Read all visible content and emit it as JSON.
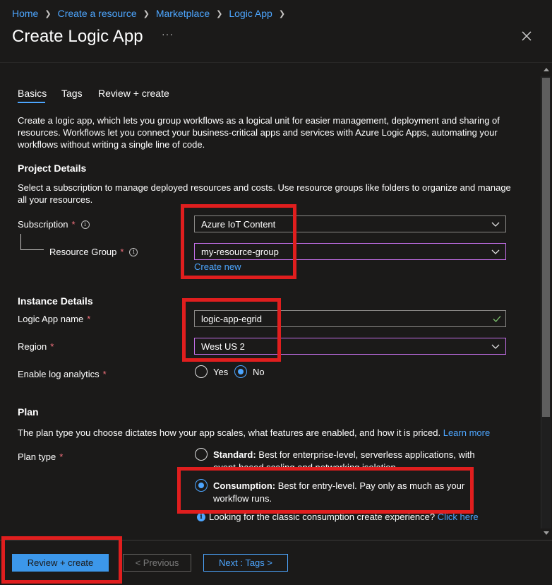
{
  "breadcrumb": [
    "Home",
    "Create a resource",
    "Marketplace",
    "Logic App"
  ],
  "page_title": "Create Logic App",
  "more_label": "···",
  "tabs": [
    {
      "label": "Basics",
      "active": true
    },
    {
      "label": "Tags",
      "active": false
    },
    {
      "label": "Review + create",
      "active": false
    }
  ],
  "intro_text": "Create a logic app, which lets you group workflows as a logical unit for easier management, deployment and sharing of resources. Workflows let you connect your business-critical apps and services with Azure Logic Apps, automating your workflows without writing a single line of code.",
  "project": {
    "heading": "Project Details",
    "description": "Select a subscription to manage deployed resources and costs. Use resource groups like folders to organize and manage all your resources.",
    "subscription_label": "Subscription",
    "subscription_value": "Azure IoT Content",
    "resource_group_label": "Resource Group",
    "resource_group_value": "my-resource-group",
    "create_new": "Create new"
  },
  "instance": {
    "heading": "Instance Details",
    "name_label": "Logic App name",
    "name_value": "logic-app-egrid",
    "region_label": "Region",
    "region_value": "West US 2",
    "log_label": "Enable log analytics",
    "log_options": [
      "Yes",
      "No"
    ],
    "log_selected": "No"
  },
  "plan": {
    "heading": "Plan",
    "description": "The plan type you choose dictates how your app scales, what features are enabled, and how it is priced.",
    "learn_more": "Learn more",
    "type_label": "Plan type",
    "standard_title": "Standard:",
    "standard_desc": "Best for enterprise-level, serverless applications, with event-based scaling and networking isolation.",
    "consumption_title": "Consumption:",
    "consumption_desc": "Best for entry-level. Pay only as much as your workflow runs.",
    "selected": "Consumption",
    "classic_note": "Looking for the classic consumption create experience?",
    "click_here": "Click here"
  },
  "required_mark": "*",
  "footer": {
    "review_create": "Review + create",
    "previous": "< Previous",
    "next": "Next : Tags >"
  },
  "colors": {
    "background": "#1b1a19",
    "link": "#4da6ff",
    "primary_button": "#3c97ea",
    "required": "#f1707b",
    "highlight": "#e01e1e",
    "select_accent": "#c36ee8"
  }
}
